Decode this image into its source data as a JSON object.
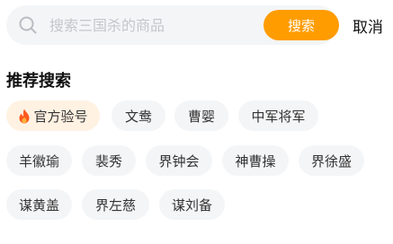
{
  "search": {
    "placeholder": "搜索三国杀的商品",
    "button_label": "搜索",
    "cancel_label": "取消"
  },
  "recommend": {
    "title": "推荐搜索",
    "tags": [
      {
        "label": "官方验号",
        "hot": true
      },
      {
        "label": "文鸯"
      },
      {
        "label": "曹婴"
      },
      {
        "label": "中军将军"
      },
      {
        "label": "羊徽瑜"
      },
      {
        "label": "裴秀"
      },
      {
        "label": "界钟会"
      },
      {
        "label": "神曹操"
      },
      {
        "label": "界徐盛"
      },
      {
        "label": "谋黄盖"
      },
      {
        "label": "界左慈"
      },
      {
        "label": "谋刘备"
      }
    ]
  },
  "colors": {
    "accent": "#ff9c00",
    "tag_bg": "#f4f5f7",
    "hot_tag_bg": "#fff2e3",
    "fire": "#ff5a1f"
  }
}
